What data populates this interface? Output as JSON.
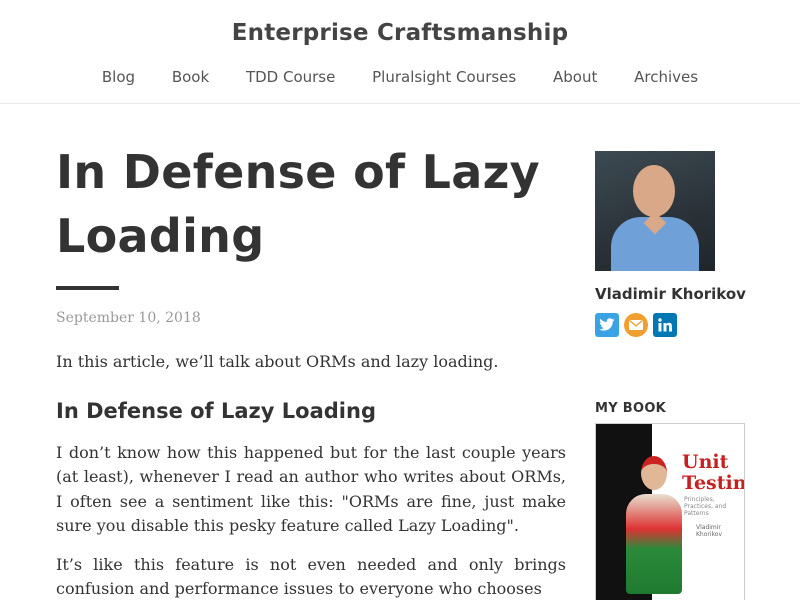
{
  "site": {
    "title": "Enterprise Craftsmanship",
    "nav": [
      "Blog",
      "Book",
      "TDD Course",
      "Pluralsight Courses",
      "About",
      "Archives"
    ]
  },
  "post": {
    "title_line1": "In Defense of Lazy",
    "title_line2": "Loading",
    "date": "September 10, 2018",
    "intro": "In this article, we’ll talk about ORMs and lazy loading.",
    "heading": "In Defense of Lazy Loading",
    "para1": "I don’t know how this happened but for the last couple years (at least), whenever I read an author who writes about ORMs, I often see a sentiment like this: \"ORMs are fine, just make sure you disable this pesky feature called Lazy Loading\".",
    "para2": "It’s like this feature is not even needed and only brings confusion and performance issues to everyone who chooses"
  },
  "sidebar": {
    "author_name": "Vladimir Khorikov",
    "social_icons": [
      "twitter-icon",
      "email-icon",
      "linkedin-icon"
    ],
    "book_label": "MY BOOK",
    "book_title": "Unit Testing",
    "book_subtitle": "Principles, Practices, and Patterns",
    "book_author": "Vladimir Khorikov"
  },
  "colors": {
    "text": "#333333",
    "muted": "#999999",
    "twitter": "#3aa3e3",
    "email": "#f0a030",
    "linkedin": "#0077b5"
  }
}
